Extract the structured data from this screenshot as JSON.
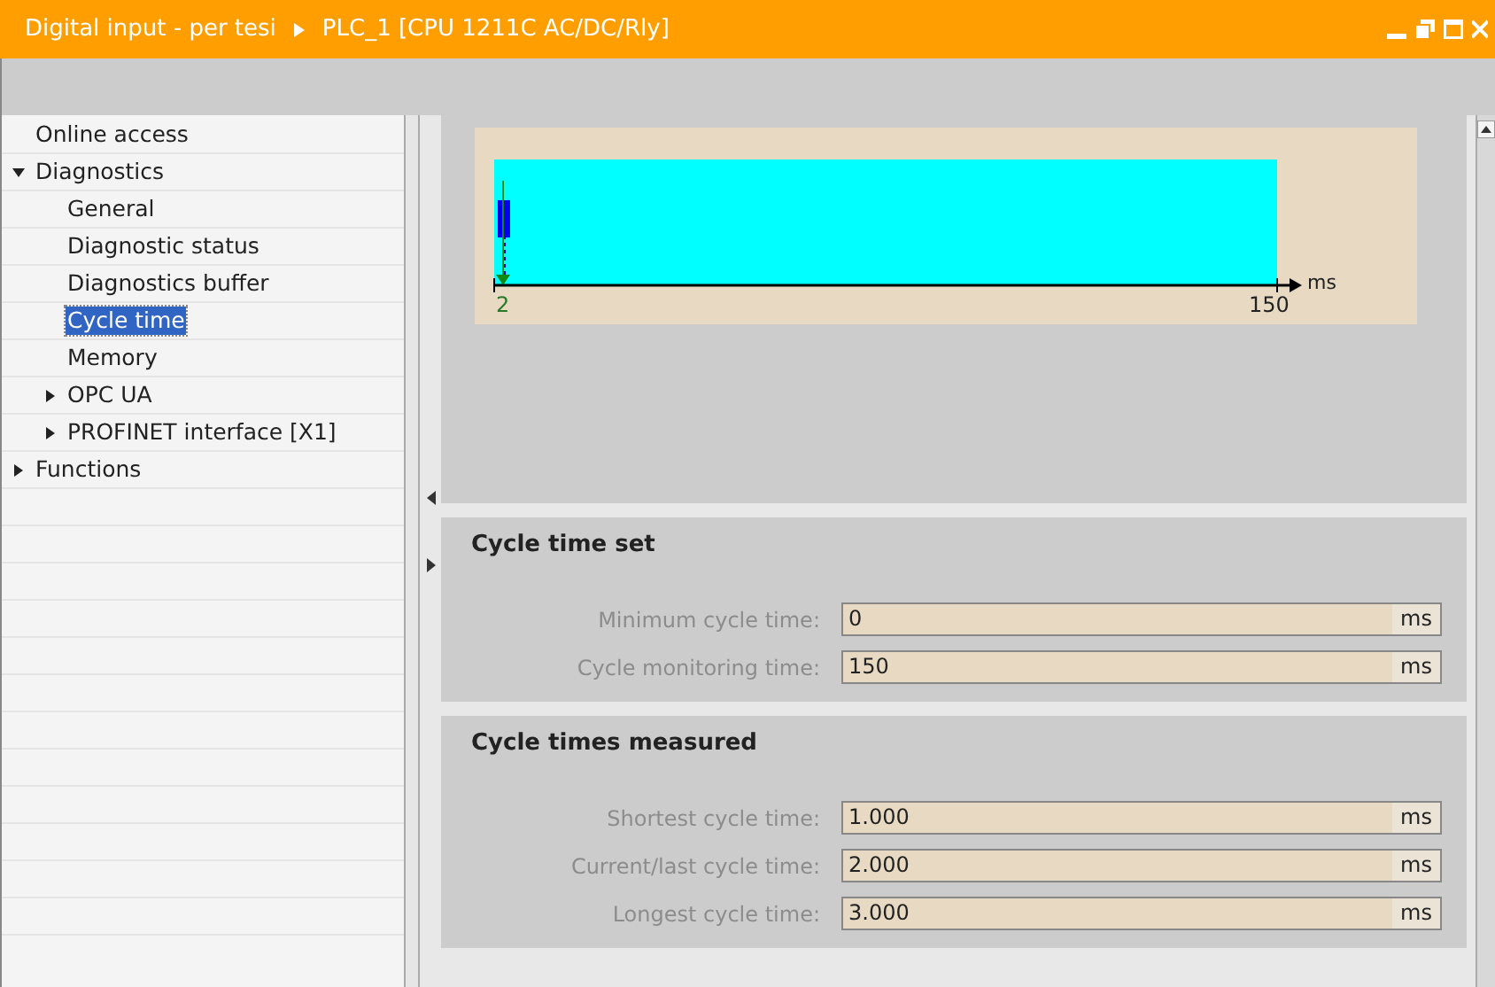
{
  "window": {
    "title": "Digital input - per tesi",
    "breadcrumb": "PLC_1 [CPU 1211C AC/DC/Rly]"
  },
  "tree": [
    {
      "label": "Online access",
      "selected": false
    },
    {
      "label": "Diagnostics",
      "selected": false,
      "expanded": true,
      "children": [
        {
          "label": "General",
          "selected": false
        },
        {
          "label": "Diagnostic status",
          "selected": false
        },
        {
          "label": "Diagnostics buffer",
          "selected": false
        },
        {
          "label": "Cycle time",
          "selected": true
        },
        {
          "label": "Memory",
          "selected": false
        },
        {
          "label": "OPC UA",
          "selected": false,
          "expanded": false
        },
        {
          "label": "PROFINET interface [X1]",
          "selected": false,
          "expanded": false
        }
      ]
    },
    {
      "label": "Functions",
      "selected": false,
      "expanded": false
    }
  ],
  "diagram": {
    "start_label": "2",
    "end_label": "150",
    "unit": "ms"
  },
  "sections": [
    {
      "title": "Cycle time set",
      "fields": [
        {
          "label": "Minimum cycle time:",
          "value": "0",
          "unit": "ms"
        },
        {
          "label": "Cycle monitoring time:",
          "value": "150",
          "unit": "ms"
        }
      ]
    },
    {
      "title": "Cycle times measured",
      "fields": [
        {
          "label": "Shortest cycle time:",
          "value": "1.000",
          "unit": "ms"
        },
        {
          "label": "Current/last cycle time:",
          "value": "2.000",
          "unit": "ms"
        },
        {
          "label": "Longest cycle time:",
          "value": "3.000",
          "unit": "ms"
        }
      ]
    }
  ]
}
